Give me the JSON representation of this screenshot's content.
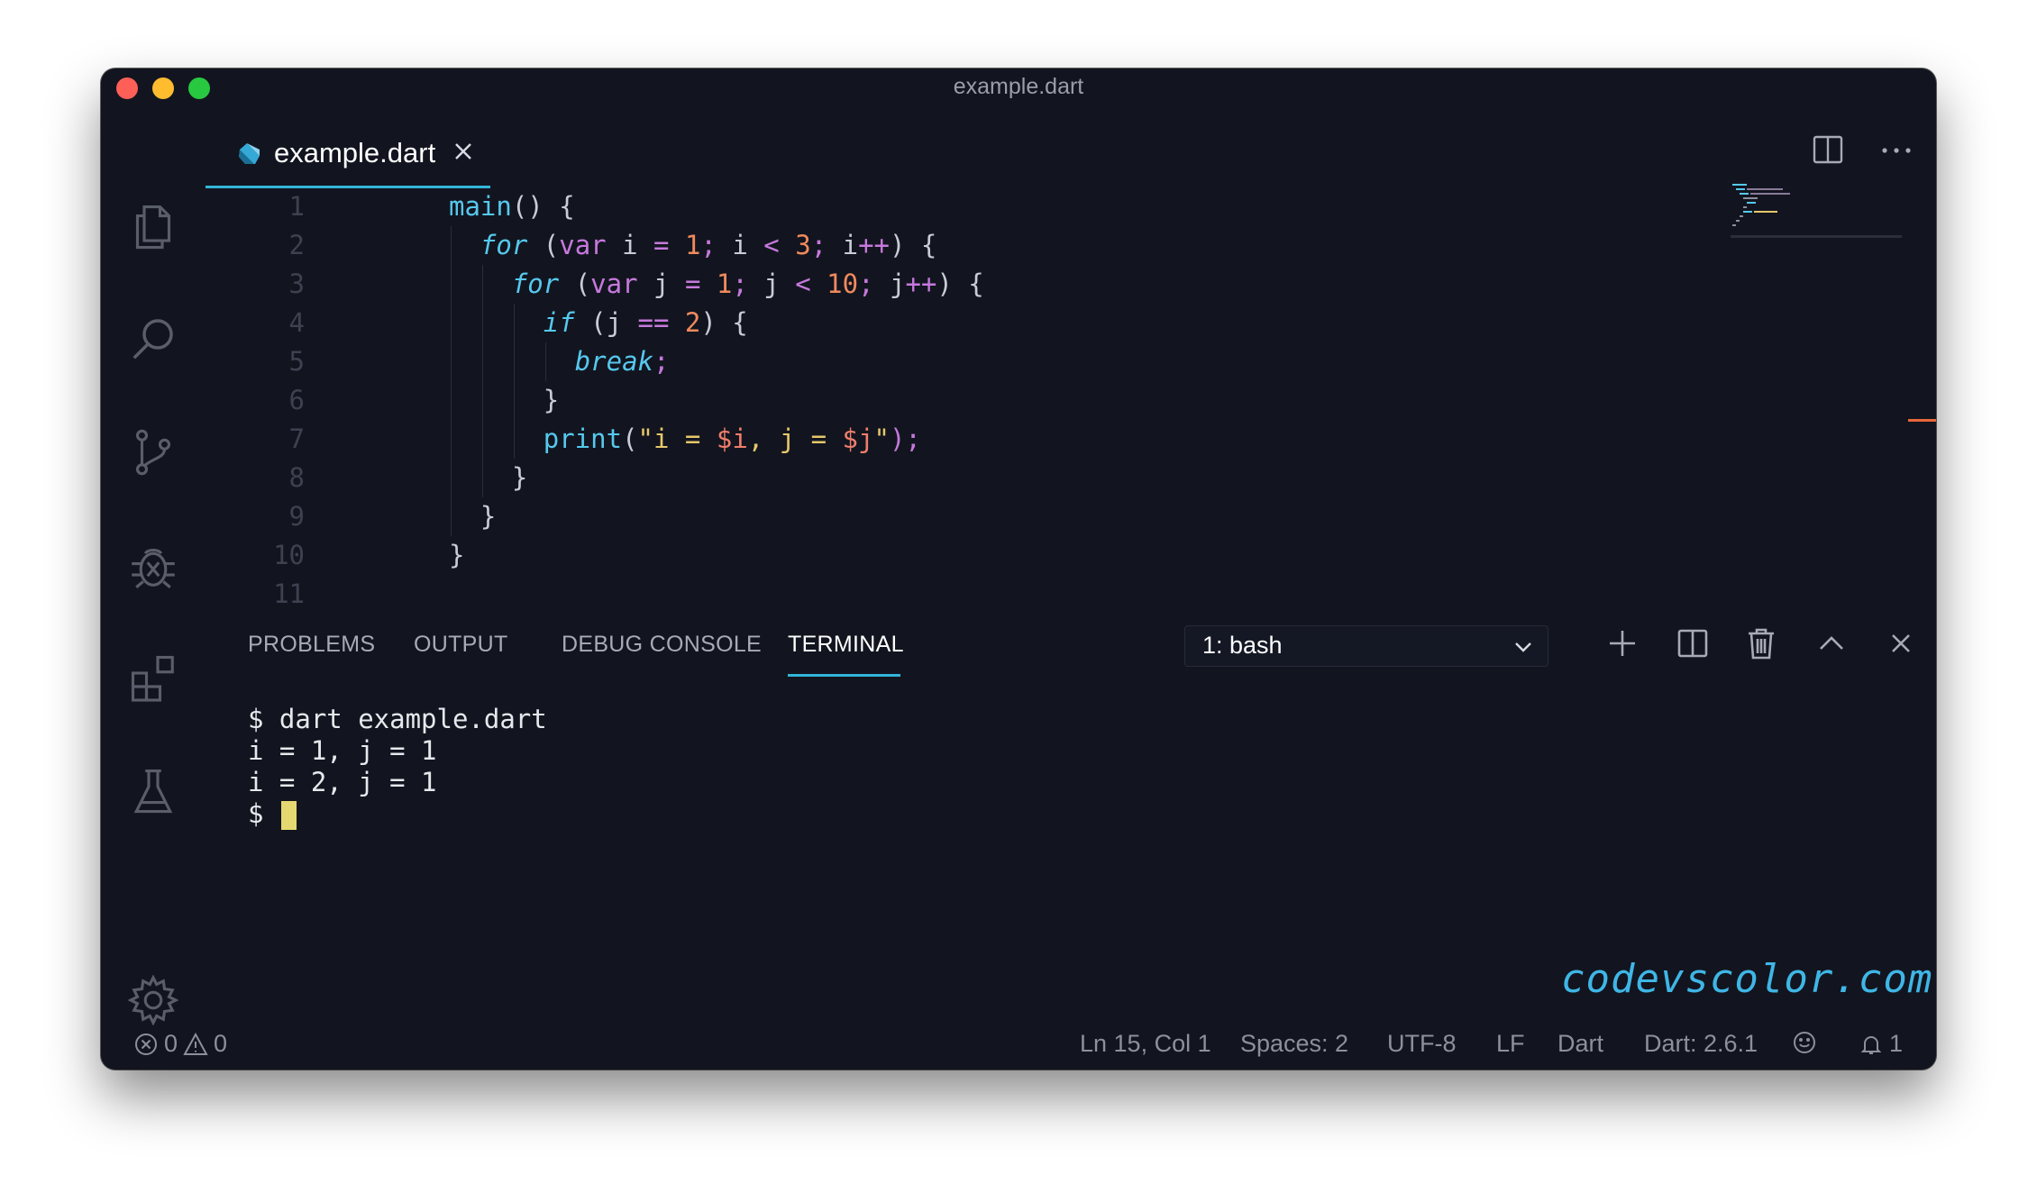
{
  "window": {
    "title": "example.dart",
    "traffic_lights": {
      "close": "#fe5f57",
      "minimize": "#febc2e",
      "maximize": "#28c840"
    }
  },
  "activity_bar": {
    "icons": [
      "files-icon",
      "search-icon",
      "source-control-icon",
      "debug-icon",
      "extensions-icon",
      "flask-icon",
      "gear-icon"
    ]
  },
  "editor_tab": {
    "label": "example.dart",
    "icon": "dart-icon",
    "accent": "#33b5d9"
  },
  "code": {
    "line_numbers": [
      "1",
      "2",
      "3",
      "4",
      "5",
      "6",
      "7",
      "8",
      "9",
      "10",
      "11"
    ],
    "lines": [
      [
        {
          "t": "main",
          "c": "k-main"
        },
        {
          "t": "() {"
        }
      ],
      [
        {
          "t": "  "
        },
        {
          "t": "for",
          "c": "k-for"
        },
        {
          "t": " ("
        },
        {
          "t": "var",
          "c": "k-var"
        },
        {
          "t": " i "
        },
        {
          "t": "=",
          "c": "op"
        },
        {
          "t": " "
        },
        {
          "t": "1",
          "c": "num"
        },
        {
          "t": ";",
          "c": "op"
        },
        {
          "t": " i "
        },
        {
          "t": "<",
          "c": "op"
        },
        {
          "t": " "
        },
        {
          "t": "3",
          "c": "num"
        },
        {
          "t": ";",
          "c": "op"
        },
        {
          "t": " i"
        },
        {
          "t": "++",
          "c": "op"
        },
        {
          "t": ") {"
        }
      ],
      [
        {
          "t": "    "
        },
        {
          "t": "for",
          "c": "k-for"
        },
        {
          "t": " ("
        },
        {
          "t": "var",
          "c": "k-var"
        },
        {
          "t": " j "
        },
        {
          "t": "=",
          "c": "op"
        },
        {
          "t": " "
        },
        {
          "t": "1",
          "c": "num"
        },
        {
          "t": ";",
          "c": "op"
        },
        {
          "t": " j "
        },
        {
          "t": "<",
          "c": "op"
        },
        {
          "t": " "
        },
        {
          "t": "10",
          "c": "num"
        },
        {
          "t": ";",
          "c": "op"
        },
        {
          "t": " j"
        },
        {
          "t": "++",
          "c": "op"
        },
        {
          "t": ") {"
        }
      ],
      [
        {
          "t": "      "
        },
        {
          "t": "if",
          "c": "k-for"
        },
        {
          "t": " (j "
        },
        {
          "t": "==",
          "c": "op"
        },
        {
          "t": " "
        },
        {
          "t": "2",
          "c": "num"
        },
        {
          "t": ") {"
        }
      ],
      [
        {
          "t": "        "
        },
        {
          "t": "break",
          "c": "k-for"
        },
        {
          "t": ";",
          "c": "op"
        }
      ],
      [
        {
          "t": "      }"
        }
      ],
      [
        {
          "t": "      "
        },
        {
          "t": "print",
          "c": "fn"
        },
        {
          "t": "("
        },
        {
          "t": "\"i = ",
          "c": "str"
        },
        {
          "t": "$i",
          "c": "interp"
        },
        {
          "t": ", j = ",
          "c": "str"
        },
        {
          "t": "$j",
          "c": "interp"
        },
        {
          "t": "\"",
          "c": "str"
        },
        {
          "t": ");",
          "c": "op"
        }
      ],
      [
        {
          "t": "    }"
        }
      ],
      [
        {
          "t": "  }"
        }
      ],
      [
        {
          "t": "}"
        }
      ],
      []
    ]
  },
  "panel": {
    "tabs": [
      "PROBLEMS",
      "OUTPUT",
      "DEBUG CONSOLE",
      "TERMINAL"
    ],
    "active_tab": "TERMINAL",
    "terminal_select": "1: bash",
    "actions": [
      "plus-icon",
      "split-terminal-icon",
      "trash-icon",
      "chevron-up-icon",
      "close-icon"
    ]
  },
  "terminal": {
    "lines": [
      "$ dart example.dart",
      "i = 1, j = 1",
      "i = 2, j = 1"
    ],
    "prompt": "$ "
  },
  "watermark": "codevscolor.com",
  "status_bar": {
    "errors": "0",
    "warnings": "0",
    "position": "Ln 15, Col 1",
    "spaces": "Spaces: 2",
    "encoding": "UTF-8",
    "eol": "LF",
    "language": "Dart",
    "sdk": "Dart: 2.6.1",
    "notifications": "1"
  }
}
